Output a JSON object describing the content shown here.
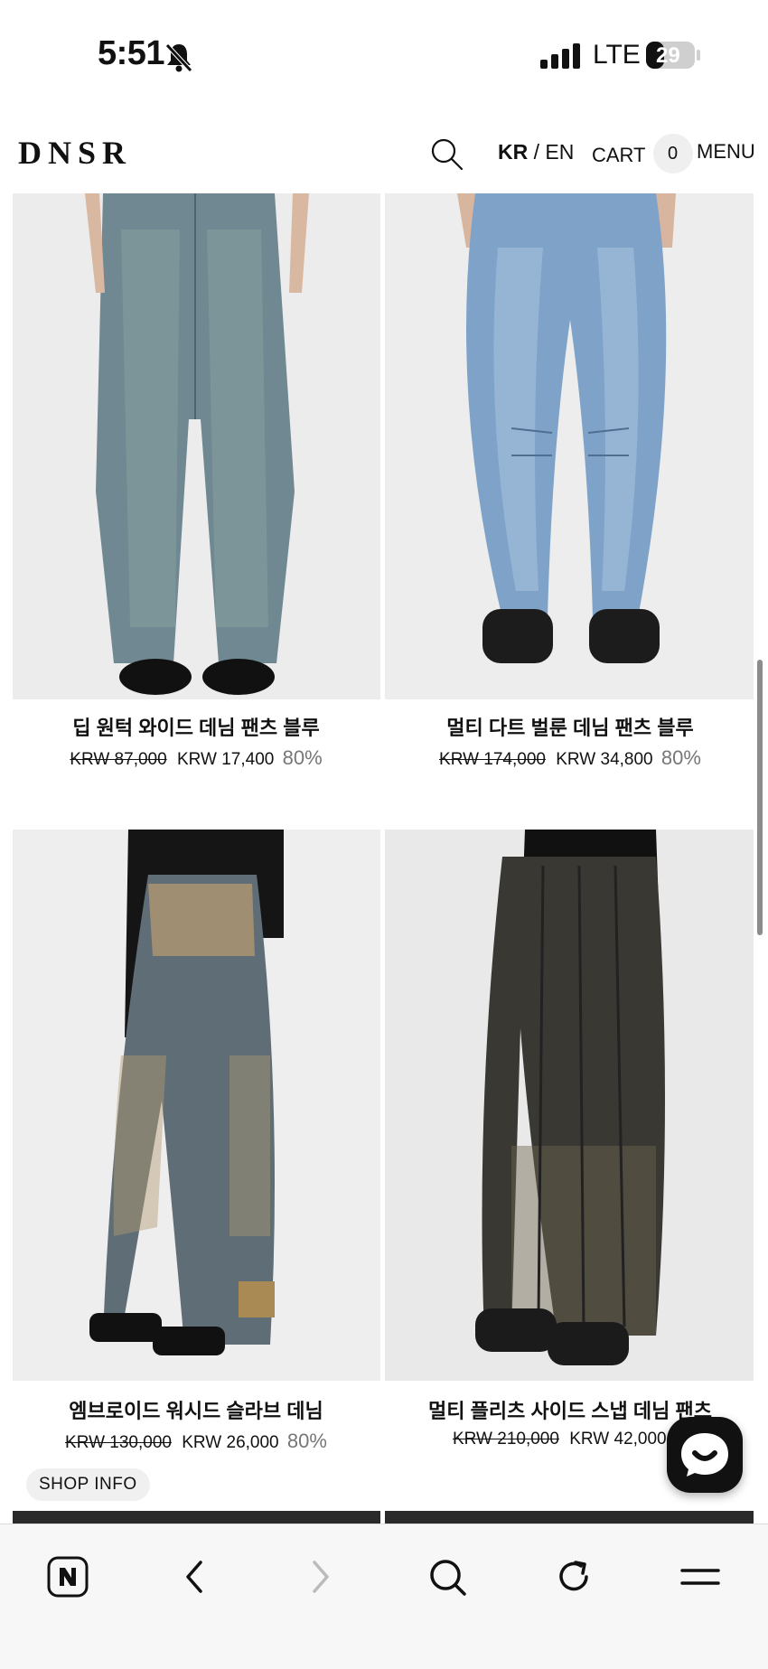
{
  "status_bar": {
    "time": "5:51",
    "network": "LTE",
    "battery": "29"
  },
  "header": {
    "logo": "DNSR",
    "lang_kr": "KR",
    "lang_sep": " / ",
    "lang_en": "EN",
    "cart_label": "CART",
    "cart_count": "0",
    "menu_label": "MENU"
  },
  "products": [
    {
      "name": "딥 원턱 와이드 데님 팬츠 블루",
      "original_price": "KRW 87,000",
      "sale_price": "KRW 17,400",
      "discount": "80%",
      "image": "light-washed wide denim jeans",
      "color": "#6f8891"
    },
    {
      "name": "멀티 다트 벌룬 데님 팬츠 블루",
      "original_price": "KRW 174,000",
      "sale_price": "KRW 34,800",
      "discount": "80%",
      "image": "balloon fit light blue denim jeans",
      "color": "#7fa3c8"
    },
    {
      "name": "엠브로이드 워시드 슬라브 데님",
      "original_price": "KRW 130,000",
      "sale_price": "KRW 26,000",
      "discount": "80%",
      "image": "washed denim with embroidery",
      "color": "#5f6e76"
    },
    {
      "name": "멀티 플리츠 사이드 스냅 데님 팬츠",
      "original_price": "KRW 210,000",
      "sale_price": "KRW 42,000",
      "discount": "",
      "image": "black washed pleated denim",
      "color": "#3a3833"
    }
  ],
  "shop_info_label": "SHOP INFO",
  "bottom_nav": {
    "items": [
      "naver-home",
      "back",
      "forward",
      "search",
      "refresh",
      "menu"
    ]
  }
}
